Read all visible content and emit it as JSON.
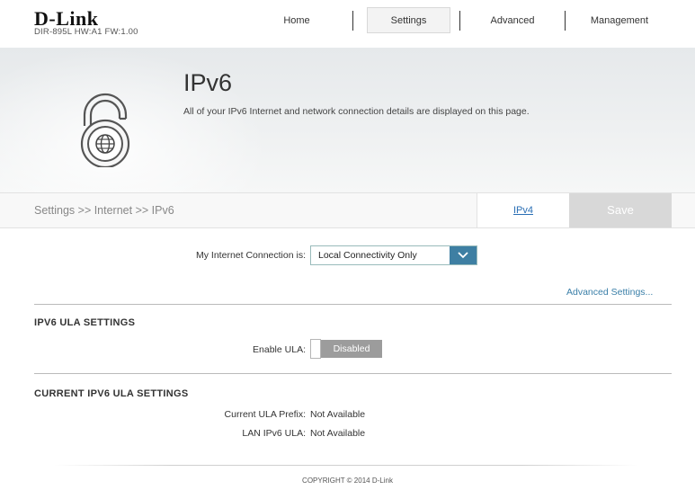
{
  "header": {
    "brand": "D-Link",
    "device_info": "DIR-895L  HW:A1  FW:1.00",
    "nav": [
      {
        "label": "Home"
      },
      {
        "label": "Settings"
      },
      {
        "label": "Advanced"
      },
      {
        "label": "Management"
      }
    ],
    "active_nav": "Settings"
  },
  "banner": {
    "title": "IPv6",
    "description": "All of your IPv6 Internet and network connection details are displayed on this page.",
    "icon": "globe-lock-icon"
  },
  "breadcrumb": {
    "path": "Settings >> Internet >> IPv6",
    "ipv4_link": "IPv4",
    "save_label": "Save"
  },
  "connection": {
    "label": "My Internet Connection is:",
    "selected": "Local Connectivity Only",
    "advanced_link": "Advanced Settings..."
  },
  "ula_settings": {
    "title": "IPV6 ULA SETTINGS",
    "enable_label": "Enable ULA:",
    "toggle_state": "Disabled"
  },
  "current_ula": {
    "title": "CURRENT IPV6 ULA SETTINGS",
    "rows": [
      {
        "label": "Current ULA Prefix:",
        "value": "Not Available"
      },
      {
        "label": "LAN IPv6 ULA:",
        "value": "Not Available"
      }
    ]
  },
  "footer": {
    "copyright": "COPYRIGHT © 2014 D-Link"
  },
  "colors": {
    "accent": "#3e7fa3",
    "link": "#2a6fb5",
    "save_bg": "#d8d8d8",
    "toggle_off": "#9c9c9c"
  }
}
